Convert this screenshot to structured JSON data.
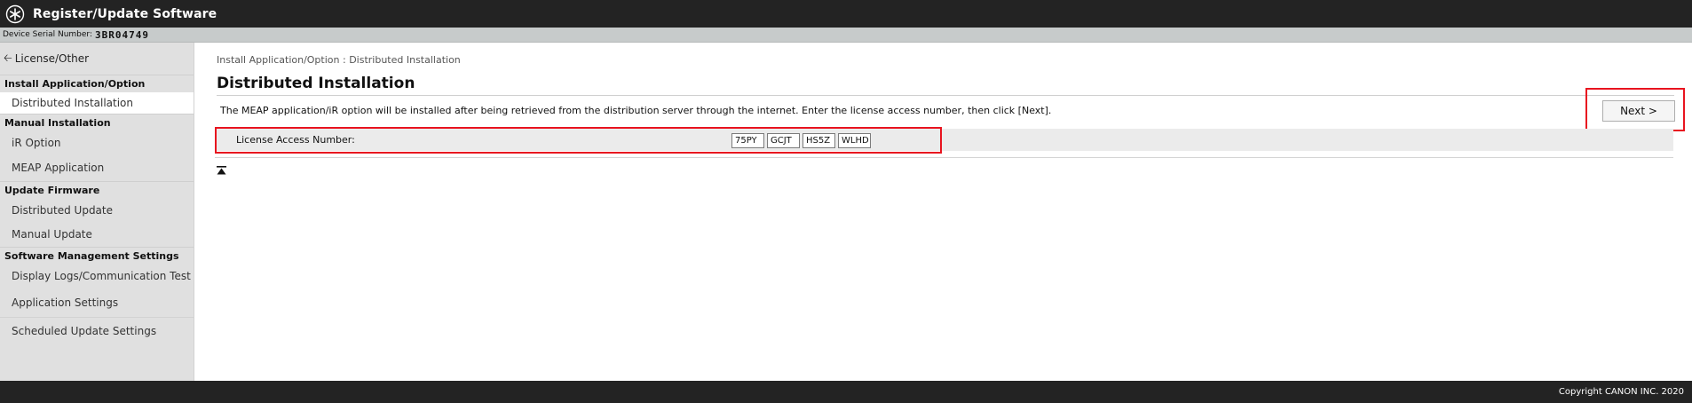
{
  "header": {
    "title": "Register/Update Software",
    "logo_icon": "gear-asterisk-icon"
  },
  "device": {
    "serial_label": "Device Serial Number:",
    "serial_value": "3BR04749"
  },
  "sidebar": {
    "back_label": "License/Other",
    "sections": [
      {
        "title": "Install Application/Option",
        "items": [
          {
            "label": "Distributed Installation",
            "active": true
          }
        ]
      },
      {
        "title": "Manual Installation",
        "items": [
          {
            "label": "iR Option"
          },
          {
            "label": "MEAP Application"
          }
        ]
      },
      {
        "title": "Update Firmware",
        "items": [
          {
            "label": "Distributed Update"
          },
          {
            "label": "Manual Update"
          }
        ]
      },
      {
        "title": "Software Management Settings",
        "items": [
          {
            "label": "Display Logs/Communication Test"
          },
          {
            "label": "Application Settings"
          },
          {
            "label": "Scheduled Update Settings"
          }
        ]
      }
    ]
  },
  "main": {
    "breadcrumb": "Install Application/Option : Distributed Installation",
    "title": "Distributed Installation",
    "description": "The MEAP application/iR option will be installed after being retrieved from the distribution server through the internet. Enter the license access number, then click [Next].",
    "next_label": "Next >",
    "license_label": "License Access Number:",
    "license_values": [
      "75PY",
      "GCJT",
      "HS5Z",
      "WLHD"
    ],
    "top_icon": "back-to-top-icon"
  },
  "footer": {
    "copyright": "Copyright CANON INC. 2020"
  },
  "colors": {
    "header_bg": "#232323",
    "sidebar_bg": "#e0e0e0",
    "highlight_red": "#e8141f"
  }
}
